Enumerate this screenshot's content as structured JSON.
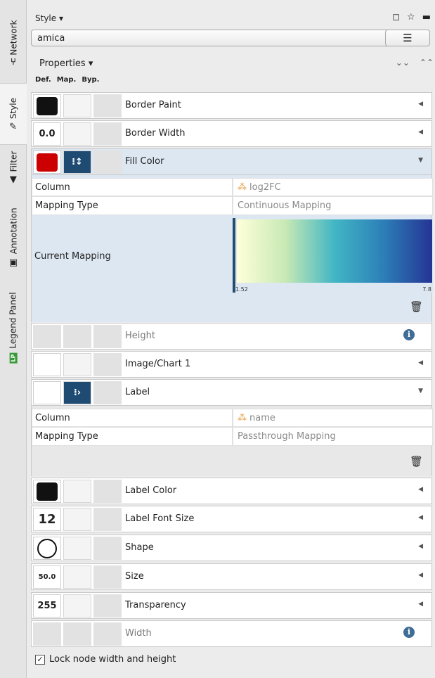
{
  "side_tabs": [
    {
      "label": "Network",
      "icon": "network-icon"
    },
    {
      "label": "Style",
      "icon": "brush-icon",
      "selected": true
    },
    {
      "label": "Filter",
      "icon": "filter-icon"
    },
    {
      "label": "Annotation",
      "icon": "annotation-icon"
    },
    {
      "label": "Legend Panel",
      "icon": "legend-icon",
      "badge": "LP"
    }
  ],
  "panel": {
    "title": "Style",
    "style_name": "amica",
    "properties_label": "Properties",
    "col_def": "Def.",
    "col_map": "Map.",
    "col_byp": "Byp."
  },
  "rows": {
    "border_paint": {
      "name": "Border Paint",
      "default_color": "#111111"
    },
    "border_width": {
      "name": "Border Width",
      "default_value": "0.0"
    },
    "fill_color": {
      "name": "Fill Color",
      "default_color": "#cc0000"
    },
    "height": {
      "name": "Height"
    },
    "image_chart": {
      "name": "Image/Chart 1"
    },
    "label": {
      "name": "Label"
    },
    "label_color": {
      "name": "Label Color",
      "default_color": "#111111"
    },
    "label_font_size": {
      "name": "Label Font Size",
      "default_value": "12"
    },
    "shape": {
      "name": "Shape"
    },
    "size": {
      "name": "Size",
      "default_value": "50.0"
    },
    "transparency": {
      "name": "Transparency",
      "default_value": "255"
    },
    "width": {
      "name": "Width"
    }
  },
  "fill_mapping": {
    "column_label": "Column",
    "column_value": "log2FC",
    "type_label": "Mapping Type",
    "type_value": "Continuous Mapping",
    "current_label": "Current Mapping",
    "range_min": "1.52",
    "range_max": "7.8"
  },
  "label_mapping": {
    "column_label": "Column",
    "column_value": "name",
    "type_label": "Mapping Type",
    "type_value": "Passthrough Mapping"
  },
  "lock_label": "Lock node width and height"
}
